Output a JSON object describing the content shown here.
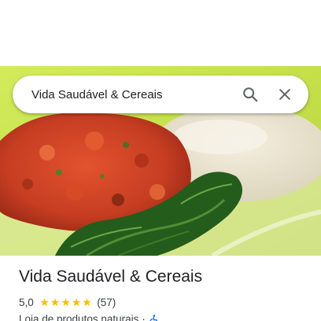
{
  "search": {
    "query": "Vida Saudável & Cereais",
    "search_icon": "search-icon",
    "close_icon": "close-icon"
  },
  "place": {
    "title": "Vida Saudável & Cereais",
    "rating": "5,0",
    "rating_value": 5,
    "stars_total": 5,
    "review_count": "(57)",
    "category": "Loja de produtos naturais",
    "separator": "·",
    "accessibility_icon": "wheelchair-icon"
  },
  "colors": {
    "star": "#fbbc04",
    "accessibility": "#1a73e8",
    "container_green": "#c8e34a"
  }
}
